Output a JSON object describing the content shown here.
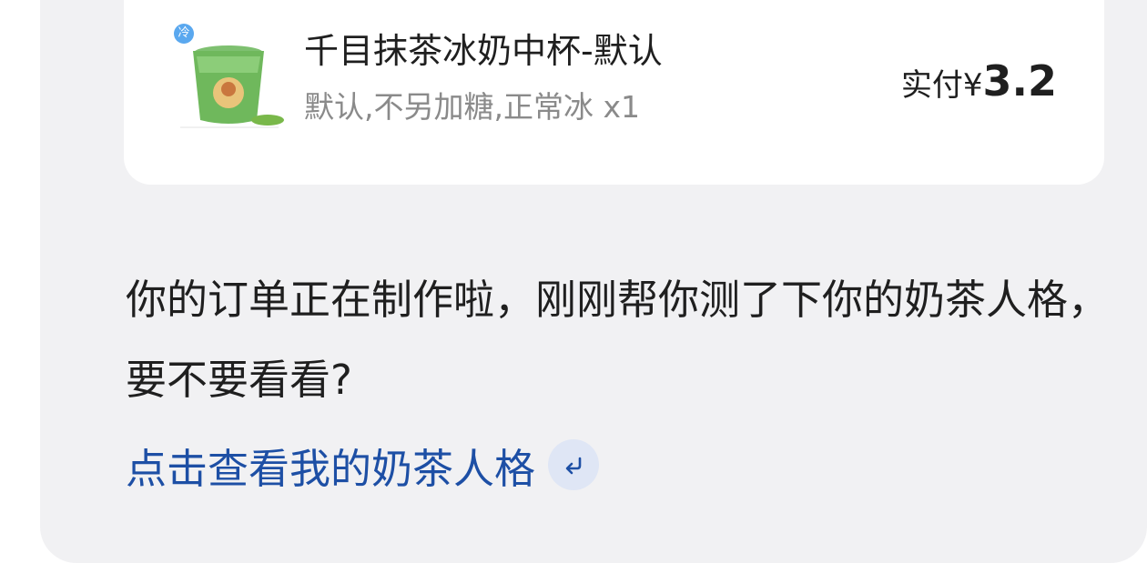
{
  "order": {
    "product_name": "千目抹茶冰奶中杯-默认",
    "product_spec": "默认,不另加糖,正常冰 x1",
    "price_label": "实付",
    "price_currency": "¥",
    "price_value": "3.2",
    "cold_tag": "冷"
  },
  "message": {
    "text": "你的订单正在制作啦，刚刚帮你测了下你的奶茶人格，要不要看看?",
    "link_text": "点击查看我的奶茶人格"
  },
  "icons": {
    "product": "matcha-drink-icon",
    "link": "enter-arrow-icon"
  },
  "colors": {
    "link": "#1d4fa5",
    "chat_background": "#f1f1f3",
    "card": "#ffffff"
  }
}
